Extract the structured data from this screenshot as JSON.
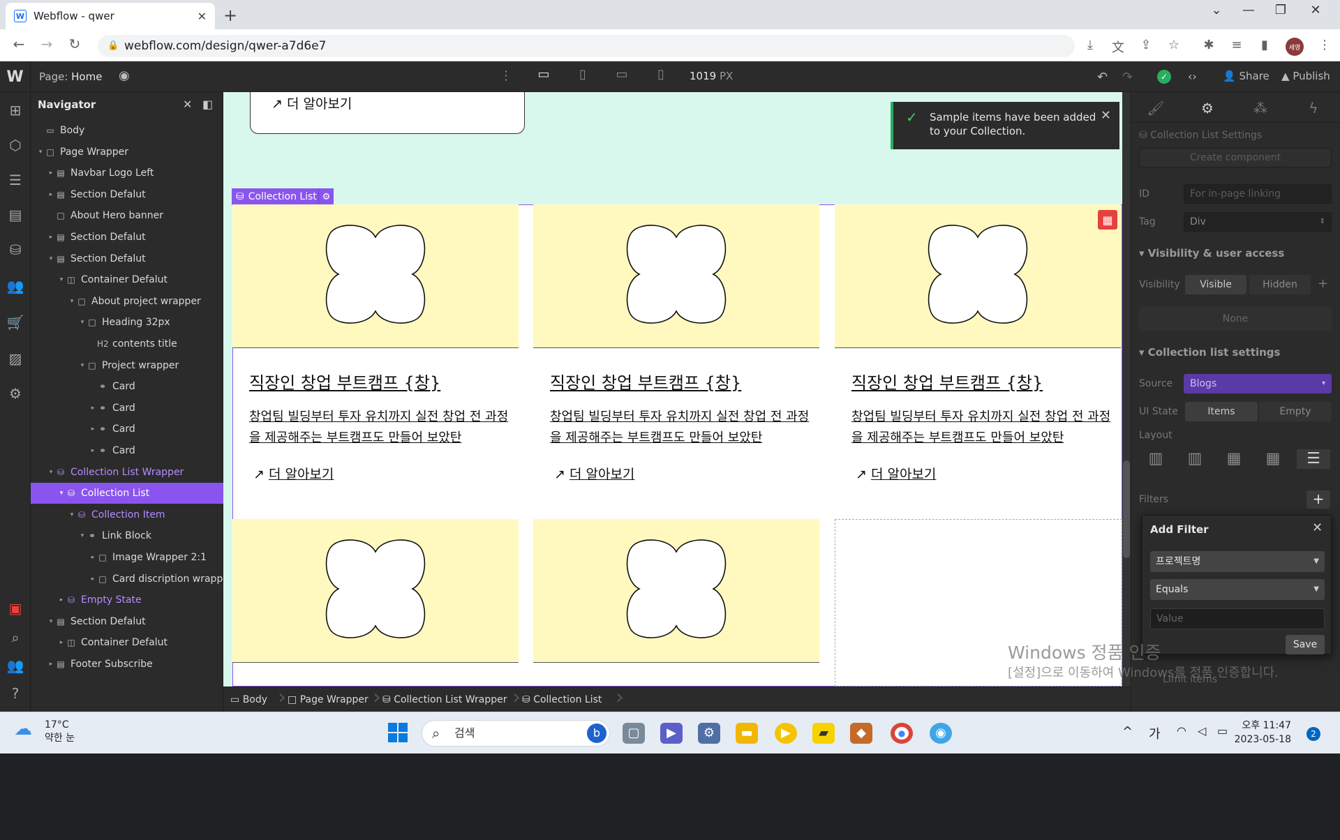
{
  "browser": {
    "tab_title": "Webflow - qwer",
    "tab_favicon": "W",
    "url": "webflow.com/design/qwer-a7d6e7",
    "profile_initials": "세영"
  },
  "webflow": {
    "page_label": "Page:",
    "page_name": "Home",
    "canvas_width": "1019",
    "canvas_unit": "PX",
    "share_label": "Share",
    "publish_label": "Publish"
  },
  "navigator": {
    "title": "Navigator",
    "rows": [
      {
        "label": "Body",
        "icon": "body-icon"
      },
      {
        "label": "Page Wrapper",
        "icon": "div-icon"
      },
      {
        "label": "Navbar Logo Left",
        "icon": "section-icon"
      },
      {
        "label": "Section Defalut",
        "icon": "section-icon"
      },
      {
        "label": "About Hero banner",
        "icon": "div-icon"
      },
      {
        "label": "Section Defalut",
        "icon": "section-icon"
      },
      {
        "label": "Section Defalut",
        "icon": "section-icon"
      },
      {
        "label": "Container Defalut",
        "icon": "container-icon"
      },
      {
        "label": "About project wrapper",
        "icon": "div-icon"
      },
      {
        "label": "Heading 32px",
        "icon": "div-icon"
      },
      {
        "label": "contents title",
        "icon": "heading-icon"
      },
      {
        "label": "Project wrapper",
        "icon": "div-icon"
      },
      {
        "label": "Card",
        "icon": "link-icon"
      },
      {
        "label": "Card",
        "icon": "link-icon"
      },
      {
        "label": "Card",
        "icon": "link-icon"
      },
      {
        "label": "Card",
        "icon": "link-icon"
      },
      {
        "label": "Collection List Wrapper",
        "icon": "collection-icon"
      },
      {
        "label": "Collection List",
        "icon": "collection-icon"
      },
      {
        "label": "Collection Item",
        "icon": "collection-icon"
      },
      {
        "label": "Link Block",
        "icon": "link-icon"
      },
      {
        "label": "Image Wrapper 2:1",
        "icon": "div-icon"
      },
      {
        "label": "Card discription wrapper",
        "icon": "div-icon"
      },
      {
        "label": "Empty State",
        "icon": "collection-icon"
      },
      {
        "label": "Section Defalut",
        "icon": "section-icon"
      },
      {
        "label": "Container Defalut",
        "icon": "container-icon"
      },
      {
        "label": "Footer Subscribe",
        "icon": "section-icon"
      }
    ]
  },
  "canvas": {
    "top_link": "더 알아보기",
    "collection_tag": "Collection List",
    "toast": "Sample items have been added to your Collection.",
    "card": {
      "title": "직장인 창업 부트캠프 {창}",
      "desc": "창업팀 빌딩부터 투자 유치까지 실전 창업 전 과정을 제공해주는 부트캠프도 만들어 보았탄",
      "link": "더 알아보기"
    }
  },
  "breadcrumbs": [
    "Body",
    "Page Wrapper",
    "Collection List Wrapper",
    "Collection List"
  ],
  "right_panel": {
    "collection_settings_label": "Collection List Settings",
    "create_component": "Create component",
    "id_label": "ID",
    "id_placeholder": "For in-page linking",
    "tag_label": "Tag",
    "tag_value": "Div",
    "visibility_section": "Visibility & user access",
    "visibility_label": "Visibility",
    "visible": "Visible",
    "hidden": "Hidden",
    "none": "None",
    "cl_section": "Collection list settings",
    "source_label": "Source",
    "source_value": "Blogs",
    "ui_state_label": "UI State",
    "items": "Items",
    "empty": "Empty",
    "layout_label": "Layout",
    "filters_label": "Filters",
    "limit_items": "Limit items"
  },
  "add_filter": {
    "title": "Add Filter",
    "field": "프로젝트명",
    "operator": "Equals",
    "value_placeholder": "Value",
    "save": "Save"
  },
  "watermark": {
    "line1": "Windows 정품 인증",
    "line2": "[설정]으로 이동하여 Windows를 정품 인증합니다."
  },
  "taskbar": {
    "temp": "17°C",
    "weather": "약한 눈",
    "search": "검색",
    "ime": "가",
    "time": "오후 11:47",
    "date": "2023-05-18",
    "notifications": "2"
  },
  "colors": {
    "accent": "#8a55ee",
    "canvas_bg": "#d8f8ee",
    "card_image_bg": "#fff9bf",
    "toast_success": "#27ae60"
  }
}
